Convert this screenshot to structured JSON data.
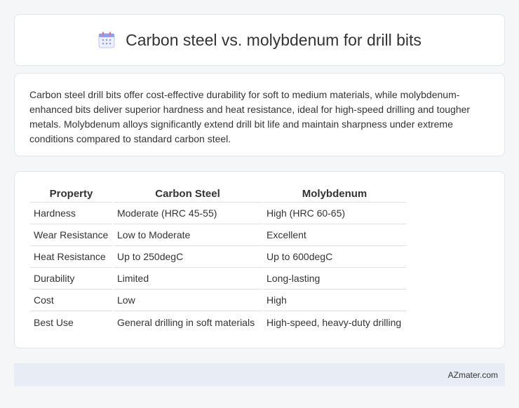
{
  "header": {
    "icon": "calendar-icon",
    "title": "Carbon steel vs. molybdenum for drill bits"
  },
  "summary": {
    "text": "Carbon steel drill bits offer cost-effective durability for soft to medium materials, while molybdenum-enhanced bits deliver superior hardness and heat resistance, ideal for high-speed drilling and tougher metals. Molybdenum alloys significantly extend drill bit life and maintain sharpness under extreme conditions compared to standard carbon steel."
  },
  "table": {
    "headers": [
      "Property",
      "Carbon Steel",
      "Molybdenum"
    ],
    "rows": [
      [
        "Hardness",
        "Moderate (HRC 45-55)",
        "High (HRC 60-65)"
      ],
      [
        "Wear Resistance",
        "Low to Moderate",
        "Excellent"
      ],
      [
        "Heat Resistance",
        "Up to 250degC",
        "Up to 600degC"
      ],
      [
        "Durability",
        "Limited",
        "Long-lasting"
      ],
      [
        "Cost",
        "Low",
        "High"
      ],
      [
        "Best Use",
        "General drilling in soft materials",
        "High-speed, heavy-duty drilling"
      ]
    ]
  },
  "footer": {
    "site": "AZmater.com"
  },
  "colors": {
    "background": "#f5f6f8",
    "card": "#ffffff",
    "footer": "#e8edf5",
    "icon_accent": "#7b8de0"
  }
}
